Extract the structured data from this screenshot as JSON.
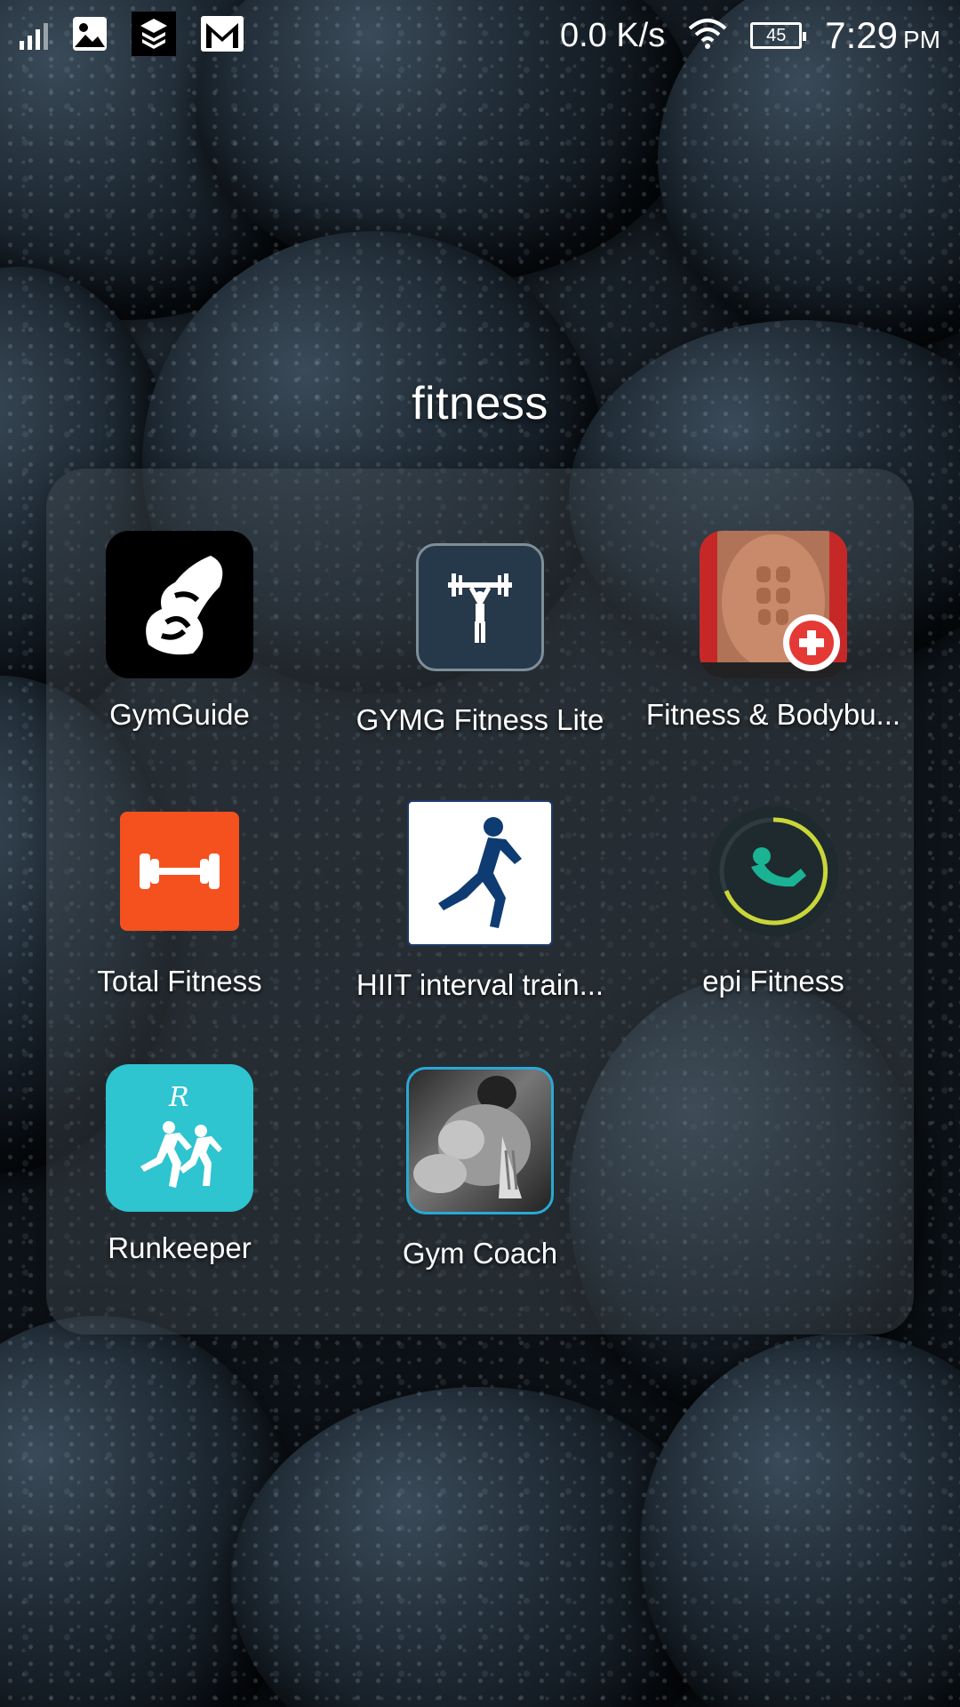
{
  "status_bar": {
    "net_speed": "0.0 K/s",
    "battery_level": "45",
    "time": "7:29",
    "ampm": "PM",
    "icons": [
      "signal-icon",
      "gallery-icon",
      "layers-app-icon",
      "gmail-icon",
      "wifi-icon",
      "battery-icon"
    ]
  },
  "folder": {
    "title": "fitness",
    "apps": [
      {
        "label": "GymGuide",
        "icon": "gymguide-icon"
      },
      {
        "label": "GYMG Fitness Lite",
        "icon": "gymg-fitness-icon"
      },
      {
        "label": "Fitness & Bodybu...",
        "icon": "fitness-bodybuilding-icon"
      },
      {
        "label": "Total Fitness",
        "icon": "total-fitness-icon"
      },
      {
        "label": "HIIT interval train...",
        "icon": "hiit-interval-icon"
      },
      {
        "label": "epi Fitness",
        "icon": "epi-fitness-icon"
      },
      {
        "label": "Runkeeper",
        "icon": "runkeeper-icon"
      },
      {
        "label": "Gym Coach",
        "icon": "gym-coach-icon"
      }
    ]
  },
  "colors": {
    "total_fitness": "#f4511e",
    "runkeeper": "#2ec4d0",
    "gymg": "#25394a",
    "epi_ring": "#c9d638"
  }
}
